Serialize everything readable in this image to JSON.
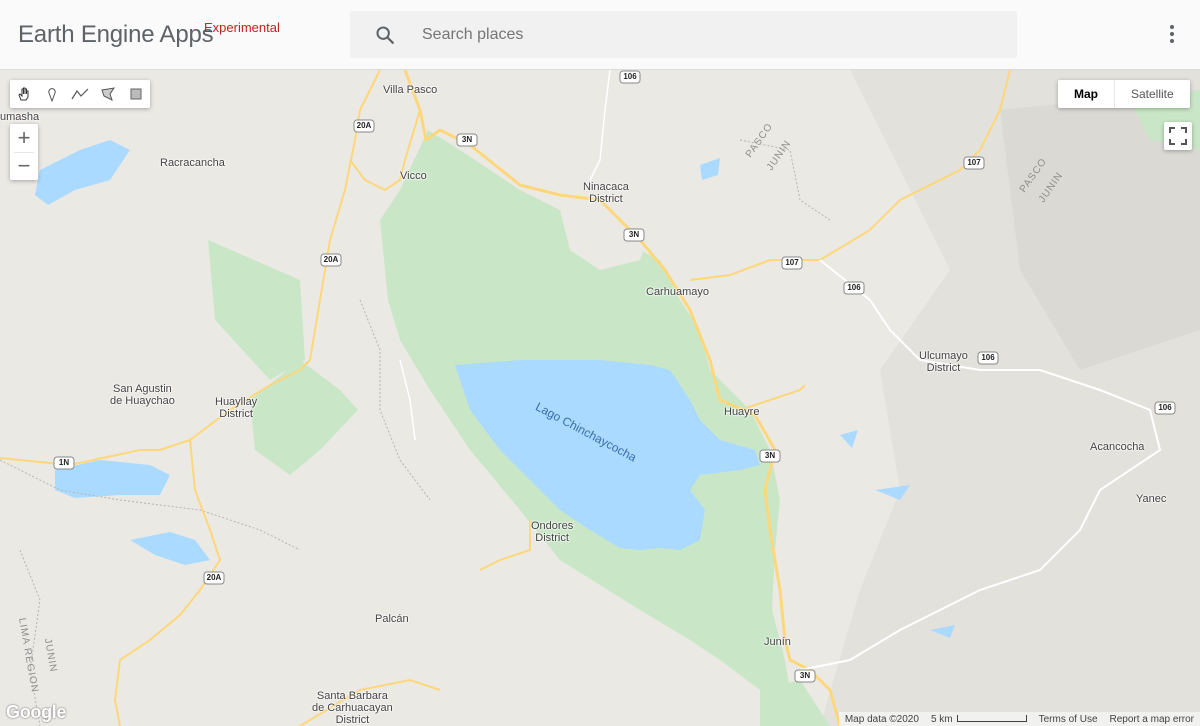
{
  "header": {
    "title": "Earth Engine Apps",
    "badge": "Experimental",
    "search_placeholder": "Search places"
  },
  "map_controls": {
    "tools": [
      "hand-icon",
      "marker-icon",
      "line-icon",
      "polygon-icon",
      "rectangle-icon"
    ],
    "zoom_in": "+",
    "zoom_out": "−",
    "map_type": [
      "Map",
      "Satellite"
    ],
    "map_type_selected": "Map"
  },
  "map": {
    "places": [
      "umasha",
      "Racracancha",
      "Villa Pasco",
      "Vicco",
      "Ninacaca\nDistrict",
      "Carhuamayo",
      "San Agustin\nde Huaychao",
      "Huayllay\nDistrict",
      "Ulcumayo\nDistrict",
      "Huayre",
      "Acancocha",
      "Yanec",
      "Ondores\nDistrict",
      "Palcán",
      "Junín",
      "Santa Barbara\nde Carhuacayan\nDistrict"
    ],
    "lake": "Lago Chinchaycocha",
    "regions": [
      "PASCO",
      "JUNIN",
      "PASCO",
      "JUNIN",
      "LIMA REGION",
      "JUNIN"
    ],
    "route_shields": [
      "106",
      "20A",
      "3N",
      "3N",
      "20A",
      "107",
      "107",
      "106",
      "106",
      "106",
      "1N",
      "3N",
      "20A",
      "3N"
    ]
  },
  "footer": {
    "logo": "Google",
    "map_data": "Map data ©2020",
    "scale": "5 km",
    "terms": "Terms of Use",
    "report": "Report a map error"
  },
  "colors": {
    "water": "#aadaff",
    "park": "#c9e7c7",
    "road": "#fdd77a",
    "land": "#ebe9e4"
  }
}
